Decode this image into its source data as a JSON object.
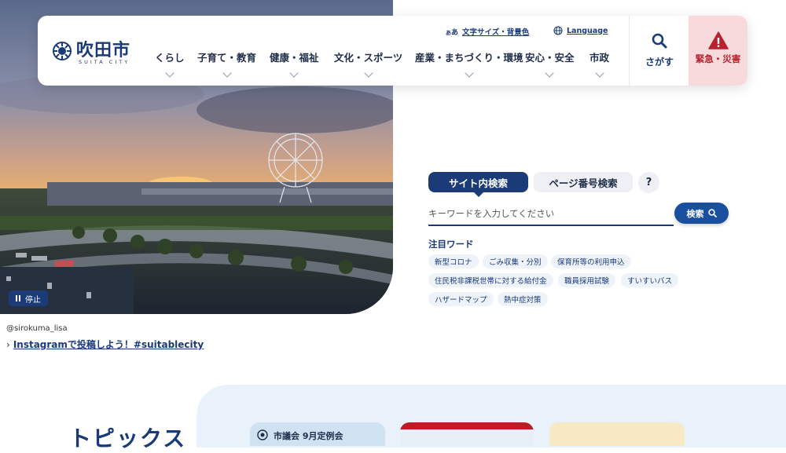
{
  "hero": {
    "pause_label": "停止",
    "credit": "@sirokuma_lisa",
    "instagram_link": "Instagramで投稿しよう！#suitablecity"
  },
  "header": {
    "logo": {
      "name": "吹田市",
      "sub": "SUITA CITY"
    },
    "utility": {
      "text_size_prefix": "あ",
      "text_size_prefix_small": "あ",
      "text_size": "文字サイズ・背景色",
      "language": "Language"
    },
    "nav": [
      {
        "label": "くらし"
      },
      {
        "label": "子育て・教育"
      },
      {
        "label": "健康・福祉"
      },
      {
        "label": "文化・スポーツ"
      },
      {
        "label": "産業・まちづくり・環境"
      },
      {
        "label": "安心・安全"
      },
      {
        "label": "市政"
      }
    ],
    "search_label": "さがす",
    "emergency_label": "緊急・災害"
  },
  "search": {
    "tabs": [
      {
        "label": "サイト内検索",
        "active": true
      },
      {
        "label": "ページ番号検索",
        "active": false
      }
    ],
    "help_label": "?",
    "placeholder": "キーワードを入力してください",
    "button_label": "検索",
    "featured_title": "注目ワード",
    "featured_words": [
      "新型コロナ",
      "ごみ収集・分別",
      "保育所等の利用申込",
      "住民税非課税世帯に対する給付金",
      "職員採用試験",
      "すいすいバス",
      "ハザードマップ",
      "熱中症対策"
    ]
  },
  "bottom": {
    "topics_title": "トピックス",
    "cards": [
      {
        "label": "市議会 9月定例会"
      }
    ]
  },
  "colors": {
    "primary": "#1a3a78",
    "emergency_bg": "#f8d9dc",
    "emergency_text": "#b8212e",
    "chip_bg": "#eef3fa"
  },
  "icons": [
    "emblem-logo",
    "globe-icon",
    "search-icon",
    "warning-icon",
    "pause-icon",
    "chevron-down-icon"
  ]
}
